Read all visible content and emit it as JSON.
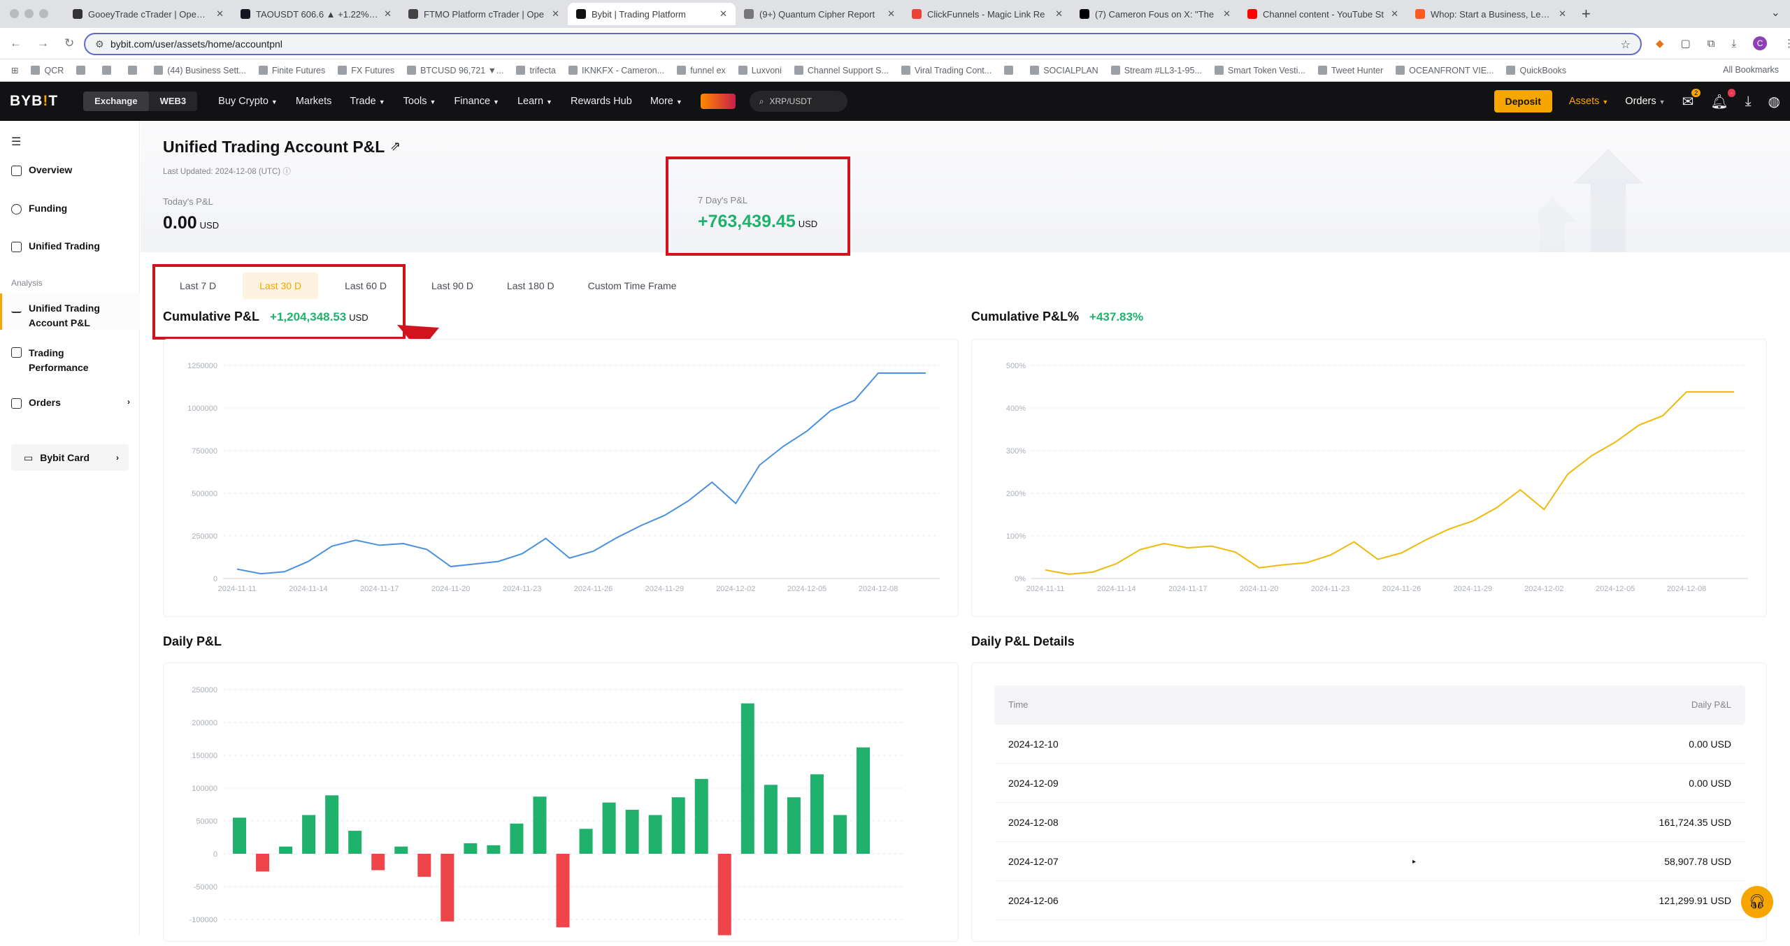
{
  "browser": {
    "tabs": [
      {
        "title": "GooeyTrade cTrader | Open Tr",
        "color": "#333"
      },
      {
        "title": "TAOUSDT 606.6 ▲ +1.22% Ti",
        "color": "#131722"
      },
      {
        "title": "FTMO Platform cTrader | Ope",
        "color": "#444"
      },
      {
        "title": "Bybit | Trading Platform",
        "color": "#121214",
        "active": true
      },
      {
        "title": "(9+) Quantum Cipher Report",
        "color": "#777"
      },
      {
        "title": "ClickFunnels - Magic Link Re",
        "color": "#ea4335"
      },
      {
        "title": "(7) Cameron Fous on X: \"The",
        "color": "#000"
      },
      {
        "title": "Channel content - YouTube St",
        "color": "#ff0000"
      },
      {
        "title": "Whop: Start a Business, Learn",
        "color": "#ff5a1f"
      }
    ],
    "url": "bybit.com/user/assets/home/accountpnl",
    "bookmarks": [
      "QCR",
      "",
      "",
      "",
      "(44) Business Sett...",
      "Finite Futures",
      "FX Futures",
      "BTCUSD 96,721 ▼...",
      "trifecta",
      "IKNKFX - Cameron...",
      "funnel ex",
      "Luxvoni",
      "Channel Support S...",
      "Viral Trading Cont...",
      "",
      "SOCIALPLAN",
      "Stream #LL3-1-95...",
      "Smart Token Vesti...",
      "Tweet Hunter",
      "OCEANFRONT VIE...",
      "QuickBooks"
    ],
    "all_bookmarks": "All Bookmarks",
    "avatar_letter": "C"
  },
  "nav": {
    "logo_a": "BYB",
    "logo_i": "!",
    "logo_b": "T",
    "seg": [
      "Exchange",
      "WEB3"
    ],
    "links": [
      "Buy Crypto",
      "Markets",
      "Trade",
      "Tools",
      "Finance",
      "Learn",
      "Rewards Hub",
      "More"
    ],
    "search": "XRP/USDT",
    "deposit": "Deposit",
    "assets": "Assets",
    "orders": "Orders",
    "msg_badge": "2"
  },
  "sidebar": {
    "items": [
      "Overview",
      "Funding",
      "Unified Trading"
    ],
    "analysis_label": "Analysis",
    "analysis_items": [
      "Unified Trading Account P&L",
      "Trading Performance",
      "Orders"
    ],
    "card": "Bybit Card"
  },
  "header": {
    "title": "Unified Trading Account P&L",
    "last_updated": "Last Updated: 2024-12-08 (UTC)",
    "today_label": "Today's P&L",
    "today_value": "0.00",
    "seven_label": "7 Day's P&L",
    "seven_value": "+763,439.45",
    "unit": "USD"
  },
  "periods": [
    "Last 7 D",
    "Last 30 D",
    "Last 60 D",
    "Last 90 D",
    "Last 180 D",
    "Custom Time Frame"
  ],
  "cumulative": {
    "label": "Cumulative P&L",
    "value": "+1,204,348.53",
    "pct_label": "Cumulative P&L%",
    "pct_value": "+437.83%"
  },
  "daily": {
    "label": "Daily P&L",
    "details_label": "Daily P&L Details",
    "col_time": "Time",
    "col_pnl": "Daily P&L",
    "rows": [
      {
        "date": "2024-12-10",
        "pnl": "0.00 USD"
      },
      {
        "date": "2024-12-09",
        "pnl": "0.00 USD"
      },
      {
        "date": "2024-12-08",
        "pnl": "161,724.35 USD"
      },
      {
        "date": "2024-12-07",
        "pnl": "58,907.78 USD"
      },
      {
        "date": "2024-12-06",
        "pnl": "121,299.91 USD"
      }
    ]
  },
  "colors": {
    "accent": "#f7a600",
    "green": "#20b26c",
    "red": "#ef454a",
    "line_blue": "#4a90e2",
    "line_orange": "#f0b90b",
    "annotation_red": "#d1131d"
  },
  "chart_data": [
    {
      "type": "line",
      "title": "",
      "x_ticks": [
        "2024-11-11",
        "2024-11-14",
        "2024-11-17",
        "2024-11-20",
        "2024-11-23",
        "2024-11-26",
        "2024-11-29",
        "2024-12-02",
        "2024-12-05",
        "2024-12-08"
      ],
      "y_ticks": [
        "0",
        "250000",
        "500000",
        "750000",
        "1000000",
        "1250000"
      ],
      "ylim": [
        0,
        1250000
      ],
      "x": [
        "2024-11-11",
        "2024-11-12",
        "2024-11-13",
        "2024-11-14",
        "2024-11-15",
        "2024-11-16",
        "2024-11-17",
        "2024-11-18",
        "2024-11-19",
        "2024-11-20",
        "2024-11-21",
        "2024-11-22",
        "2024-11-23",
        "2024-11-24",
        "2024-11-25",
        "2024-11-26",
        "2024-11-27",
        "2024-11-28",
        "2024-11-29",
        "2024-11-30",
        "2024-12-01",
        "2024-12-02",
        "2024-12-03",
        "2024-12-04",
        "2024-12-05",
        "2024-12-06",
        "2024-12-07",
        "2024-12-08",
        "2024-12-09",
        "2024-12-10"
      ],
      "values": [
        55000,
        28000,
        40000,
        100000,
        190000,
        225000,
        195000,
        205000,
        170000,
        70000,
        85000,
        100000,
        145000,
        235000,
        120000,
        160000,
        240000,
        310000,
        370000,
        455000,
        565000,
        440000,
        665000,
        775000,
        865000,
        985000,
        1045000,
        1205000,
        1205000,
        1205000
      ],
      "grid": true,
      "color": "#4a90e2"
    },
    {
      "type": "line",
      "title": "",
      "x_ticks": [
        "2024-11-11",
        "2024-11-14",
        "2024-11-17",
        "2024-11-20",
        "2024-11-23",
        "2024-11-26",
        "2024-11-29",
        "2024-12-02",
        "2024-12-05",
        "2024-12-08"
      ],
      "y_ticks": [
        "0%",
        "100%",
        "200%",
        "300%",
        "400%",
        "500%"
      ],
      "ylim": [
        0,
        500
      ],
      "x": [
        "2024-11-11",
        "2024-11-12",
        "2024-11-13",
        "2024-11-14",
        "2024-11-15",
        "2024-11-16",
        "2024-11-17",
        "2024-11-18",
        "2024-11-19",
        "2024-11-20",
        "2024-11-21",
        "2024-11-22",
        "2024-11-23",
        "2024-11-24",
        "2024-11-25",
        "2024-11-26",
        "2024-11-27",
        "2024-11-28",
        "2024-11-29",
        "2024-11-30",
        "2024-12-01",
        "2024-12-02",
        "2024-12-03",
        "2024-12-04",
        "2024-12-05",
        "2024-12-06",
        "2024-12-07",
        "2024-12-08",
        "2024-12-09",
        "2024-12-10"
      ],
      "values": [
        20,
        10,
        15,
        35,
        68,
        82,
        72,
        76,
        62,
        25,
        32,
        37,
        55,
        86,
        45,
        60,
        90,
        116,
        135,
        166,
        208,
        162,
        245,
        288,
        320,
        360,
        382,
        438,
        438,
        438
      ],
      "grid": true,
      "color": "#f0b90b"
    },
    {
      "type": "bar",
      "title": "",
      "y_ticks": [
        "250000",
        "200000",
        "150000",
        "100000",
        "50000",
        "0",
        "-50000",
        "-100000"
      ],
      "ylim": [
        -120000,
        260000
      ],
      "x": [
        "2024-11-11",
        "2024-11-12",
        "2024-11-13",
        "2024-11-14",
        "2024-11-15",
        "2024-11-16",
        "2024-11-17",
        "2024-11-18",
        "2024-11-19",
        "2024-11-20",
        "2024-11-21",
        "2024-11-22",
        "2024-11-23",
        "2024-11-24",
        "2024-11-25",
        "2024-11-26",
        "2024-11-27",
        "2024-11-28",
        "2024-11-29",
        "2024-11-30",
        "2024-12-01",
        "2024-12-02",
        "2024-12-03",
        "2024-12-04",
        "2024-12-05",
        "2024-12-06",
        "2024-12-07",
        "2024-12-08"
      ],
      "values": [
        55000,
        -27000,
        11000,
        59000,
        89000,
        35000,
        -25000,
        11000,
        -35000,
        -103000,
        16000,
        13000,
        46000,
        87000,
        -112000,
        38000,
        78000,
        67000,
        59000,
        86000,
        114000,
        -124000,
        229000,
        105000,
        86000,
        121000,
        59000,
        162000
      ],
      "grid": true
    }
  ]
}
